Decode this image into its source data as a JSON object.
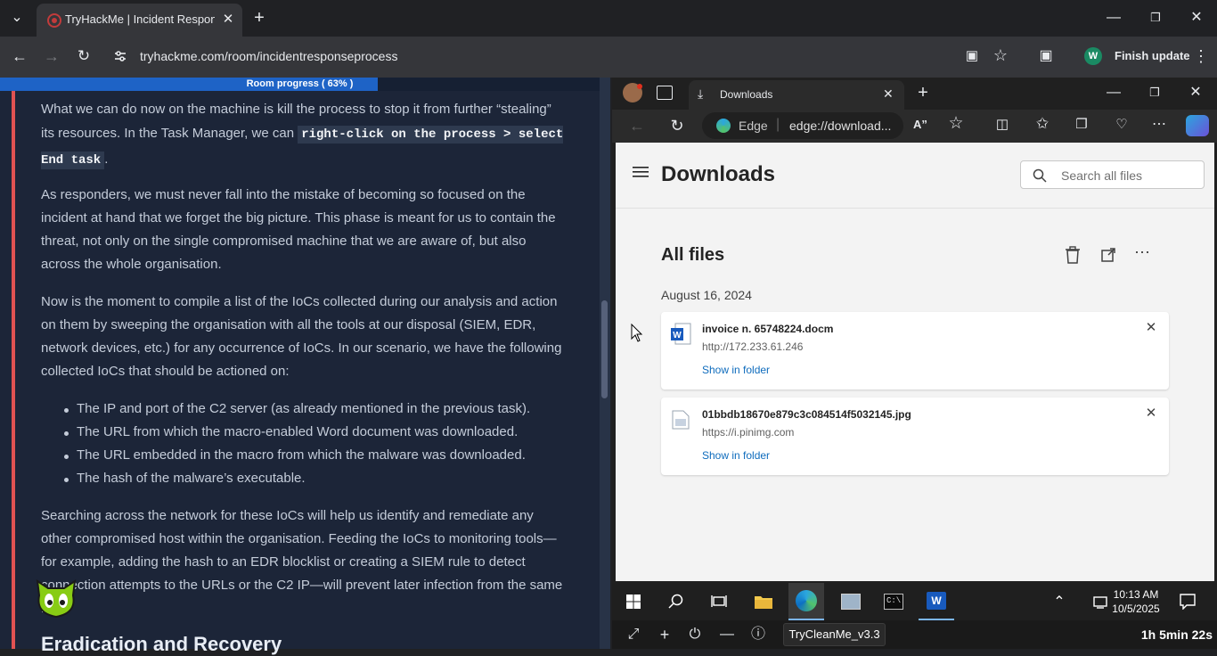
{
  "chrome": {
    "tab_title": "TryHackMe | Incident Response",
    "address": "tryhackme.com/room/incidentresponseprocess",
    "finish_update": "Finish update",
    "avatar_letter": "W"
  },
  "room": {
    "progress_label": "Room progress ( 63% )",
    "progress": 0.63,
    "para1_a": "What we can do now on the machine is kill the process to stop it from further “stealing” its resources. In the Task Manager, we can",
    "para1_code": "right-click on the process > select End task",
    "para1_end": ".",
    "para2": "As responders, we must never fall into the mistake of becoming so focused on the incident at hand that we forget the big picture. This phase is meant for us to contain the threat, not only on the single compromised machine that we are aware of, but also across the whole organisation.",
    "para3": "Now is the moment to compile a list of the IoCs collected during our analysis and action on them by sweeping the organisation with all the tools at our disposal (SIEM, EDR, network devices, etc.) for any occurrence of IoCs. In our scenario, we have the following collected IoCs that should be actioned on:",
    "list": [
      "The IP and port of the C2 server (as already mentioned in the previous task).",
      "The URL from which the macro-enabled Word document was downloaded.",
      "The URL embedded in the macro from which the malware was downloaded.",
      "The hash of the malware’s executable."
    ],
    "para4": "Searching across the network for these IoCs will help us identify and remediate any other compromised host within the organisation. Feeding the IoCs to monitoring tools—for example, adding the hash to an EDR blocklist or creating a SIEM rule to detect connection attempts to the URLs or the C2 IP—will prevent later infection from the same host.",
    "heading": "Eradication and Recovery"
  },
  "edge": {
    "tab_title": "Downloads",
    "edge_label": "Edge",
    "address": "edge://download...",
    "page_title": "Downloads",
    "search_placeholder": "Search all files",
    "section": "All files",
    "date": "August 16, 2024",
    "files": [
      {
        "name": "invoice n. 65748224.docm",
        "url": "http://172.233.61.246",
        "action": "Show in folder"
      },
      {
        "name": "01bbdb18670e879c3c084514f5032145.jpg",
        "url": "https://i.pinimg.com",
        "action": "Show in folder"
      }
    ]
  },
  "taskbar": {
    "time": "10:13 AM",
    "date": "10/5/2025"
  },
  "vm": {
    "name": "TryCleanMe_v3.3",
    "timer": "1h 5min 22s"
  }
}
